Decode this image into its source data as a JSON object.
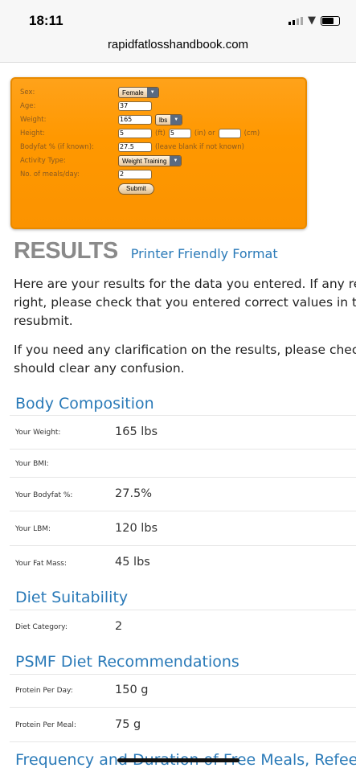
{
  "status": {
    "time": "18:11"
  },
  "browser": {
    "url": "rapidfatlosshandbook.com"
  },
  "form": {
    "sex_label": "Sex:",
    "sex_value": "Female",
    "age_label": "Age:",
    "age_value": "37",
    "weight_label": "Weight:",
    "weight_value": "165",
    "weight_unit": "lbs",
    "height_label": "Height:",
    "height_ft": "5",
    "ft": "(ft)",
    "height_in": "5",
    "in_or": "(in) or",
    "height_cm": "",
    "cm": "(cm)",
    "bodyfat_label": "Bodyfat % (if known):",
    "bodyfat_value": "27.5",
    "bodyfat_hint": "(leave blank if not known)",
    "activity_label": "Activity Type:",
    "activity_value": "Weight Training",
    "meals_label": "No. of meals/day:",
    "meals_value": "2",
    "submit": "Submit"
  },
  "results": {
    "title": "RESULTS",
    "printer": "Printer Friendly Format",
    "p1": [
      "Here are your results for the data you entered. If any re",
      "right, please check that you entered correct values in t",
      "resubmit."
    ],
    "p2": [
      "If you need any clarification on the results, please chec",
      "should clear any confusion."
    ]
  },
  "body_composition": {
    "title": "Body Composition",
    "rows": [
      {
        "k": "Your Weight:",
        "v": "165 lbs"
      },
      {
        "k": "Your BMI:",
        "v": ""
      },
      {
        "k": "Your Bodyfat %:",
        "v": "27.5%"
      },
      {
        "k": "Your LBM:",
        "v": "120 lbs"
      },
      {
        "k": "Your Fat Mass:",
        "v": "45 lbs"
      }
    ]
  },
  "diet": {
    "title": "Diet Suitability",
    "rows": [
      {
        "k": "Diet Category:",
        "v": "2"
      }
    ]
  },
  "psmf": {
    "title": "PSMF Diet Recommendations",
    "rows": [
      {
        "k": "Protein Per Day:",
        "v": "150 g"
      },
      {
        "k": "Protein Per Meal:",
        "v": "75 g"
      }
    ]
  },
  "next_section": "Frequency and Duration of Free Meals, Refeed"
}
